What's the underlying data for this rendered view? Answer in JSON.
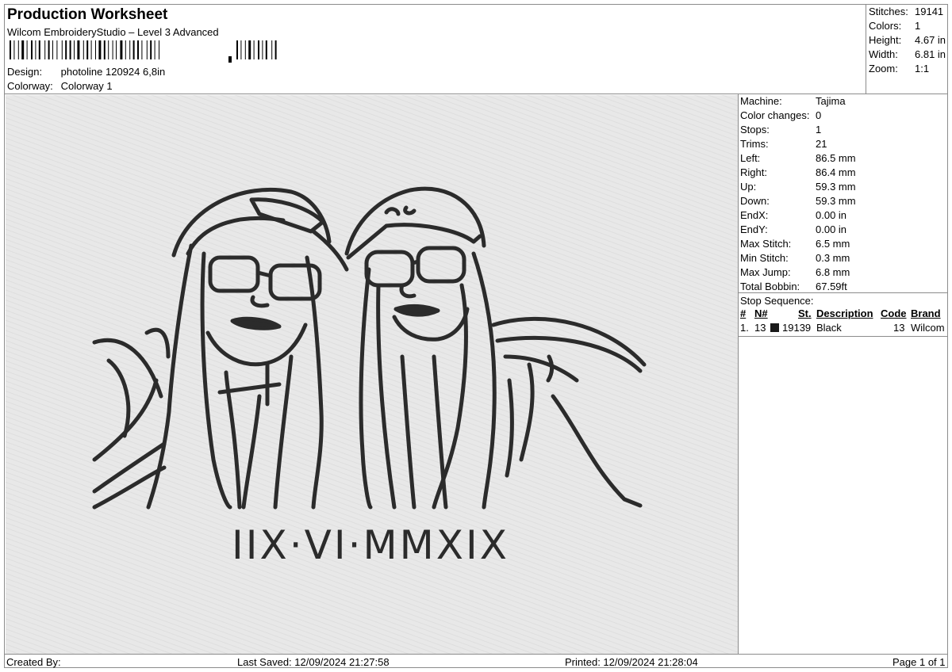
{
  "header": {
    "title": "Production Worksheet",
    "subtitle": "Wilcom EmbroideryStudio – Level 3 Advanced",
    "design_label": "Design:",
    "design_value": "photoline 120924 6,8in",
    "colorway_label": "Colorway:",
    "colorway_value": "Colorway 1"
  },
  "summary": {
    "stitches_label": "Stitches:",
    "stitches_value": "19141",
    "colors_label": "Colors:",
    "colors_value": "1",
    "height_label": "Height:",
    "height_value": "4.67 in",
    "width_label": "Width:",
    "width_value": "6.81 in",
    "zoom_label": "Zoom:",
    "zoom_value": "1:1"
  },
  "machine_info": [
    {
      "label": "Machine:",
      "value": "Tajima"
    },
    {
      "label": "Color changes:",
      "value": "0"
    },
    {
      "label": "Stops:",
      "value": "1"
    },
    {
      "label": "Trims:",
      "value": "21"
    },
    {
      "label": "Left:",
      "value": "86.5 mm"
    },
    {
      "label": "Right:",
      "value": "86.4 mm"
    },
    {
      "label": "Up:",
      "value": "59.3 mm"
    },
    {
      "label": "Down:",
      "value": "59.3 mm"
    },
    {
      "label": "EndX:",
      "value": "0.00 in"
    },
    {
      "label": "EndY:",
      "value": "0.00 in"
    },
    {
      "label": "Max Stitch:",
      "value": "6.5 mm"
    },
    {
      "label": "Min Stitch:",
      "value": "0.3 mm"
    },
    {
      "label": "Max Jump:",
      "value": "6.8 mm"
    },
    {
      "label": "Total Bobbin:",
      "value": "67.59ft"
    }
  ],
  "stop_sequence": {
    "title": "Stop Sequence:",
    "columns": [
      "#",
      "N#",
      "St.",
      "Description",
      "Code",
      "Brand"
    ],
    "rows": [
      {
        "num": "1.",
        "n": "13",
        "stitches": "19139",
        "description": "Black",
        "code": "13",
        "brand": "Wilcom",
        "color": "#1a1a1a"
      }
    ]
  },
  "design_preview": {
    "caption": "IIX·VI·MMXIX",
    "thread_color": "#2b2b2b",
    "fabric_color": "#e8e8e8"
  },
  "footer": {
    "created_by": "Created By:",
    "last_saved": "Last Saved: 12/09/2024 21:27:58",
    "printed": "Printed: 12/09/2024 21:28:04",
    "page": "Page 1 of 1"
  }
}
